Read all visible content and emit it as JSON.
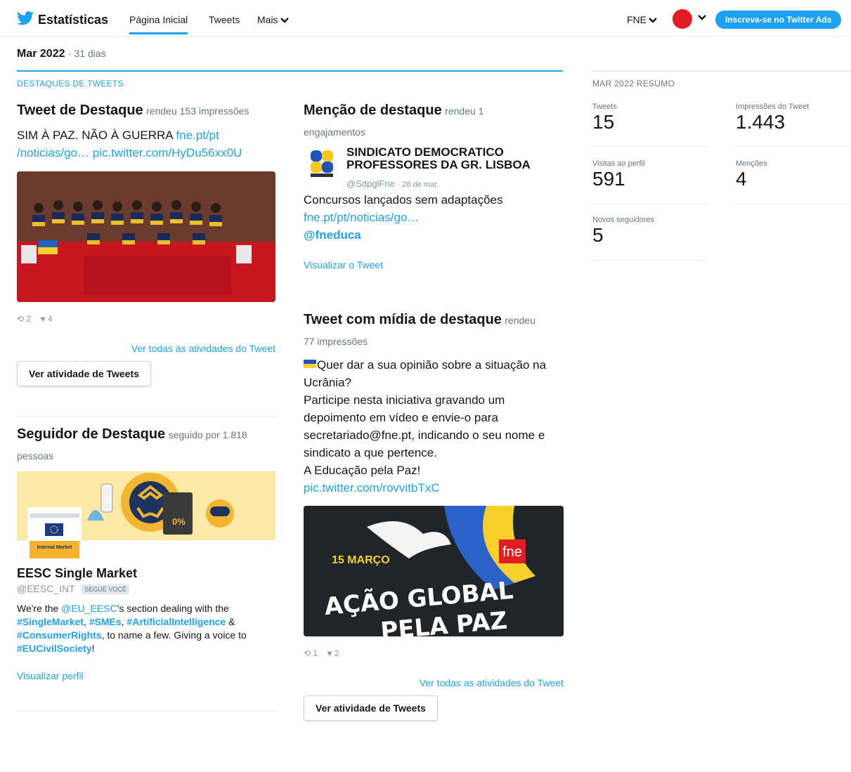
{
  "nav": {
    "brand": "Estatísticas",
    "tabs": [
      "Página Inicial",
      "Tweets",
      "Mais"
    ],
    "account": "FNE",
    "ads_button": "Inscreva-se no Twitter Ads"
  },
  "period": {
    "month": "Mar 2022",
    "days": "31 dias"
  },
  "highlights": {
    "header": "DESTAQUES DE TWEETS",
    "top_tweet": {
      "title": "Tweet de Destaque",
      "sub": "rendeu 153 impressões",
      "text": "SIM À PAZ. NÃO À GUERRA ",
      "link1": "fne.pt/pt",
      "link2": "/noticias/go…",
      "link3": "pic.twitter.com/HyDu56xx0U",
      "retweets": "2",
      "likes": "4",
      "view_all": "Ver todas as atividades do Tweet",
      "button": "Ver atividade de Tweets"
    },
    "top_follower": {
      "title": "Seguidor de Destaque",
      "sub": "seguido por 1.818",
      "sub2": "pessoas",
      "name": "EESC Single Market",
      "handle": "@EESC_INT",
      "badge": "SEGUE VOCÊ",
      "logo_text": "Internal Market",
      "bio": {
        "t1": "We're the ",
        "m1": "@EU_EESC",
        "t2": "'s section dealing with the ",
        "h1": "#SingleMarket",
        "t3": ", ",
        "h2": "#SMEs",
        "t4": ", ",
        "h3": "#ArtificialIntelligence",
        "t5": " & ",
        "h4": "#ConsumerRights",
        "t6": ", to name a few. Giving a voice to ",
        "h5": "#EUCivilSociety",
        "t7": "!"
      },
      "view_profile": "Visualizar perfil"
    },
    "top_mention": {
      "title": "Menção de destaque",
      "sub": "rendeu 1",
      "sub2": "engajamentos",
      "name": "SINDICATO DEMOCRATICO PROFESSORES DA GR. LISBOA",
      "handle": "@SdpglFne",
      "date": "· 28 de mar.",
      "text": "Concursos lançados sem adaptações",
      "link": "fne.pt/pt/noticias/go…",
      "mention": "@fneduca",
      "view": "Visualizar o Tweet"
    },
    "top_media": {
      "title": "Tweet com mídia de destaque",
      "sub": "rendeu",
      "sub2": "77 impressões",
      "lines": [
        "Quer dar a sua opinião sobre a situação na",
        "Ucrânia?",
        "Participe nesta iniciativa gravando um",
        "depoimento em vídeo e envie-o para",
        "secretariado@fne.pt, indicando o seu nome e",
        "sindicato a que pertence.",
        "A Educação pela Paz!"
      ],
      "link": "pic.twitter.com/rovvitbTxC",
      "image_date": "15 MARÇO",
      "image_line1": "AÇÃO GLOBAL",
      "image_line2": "PELA PAZ",
      "image_logo": "fne",
      "retweets": "1",
      "likes": "2",
      "view_all": "Ver todas as atividades do Tweet",
      "button": "Ver atividade de Tweets"
    }
  },
  "summary": {
    "header": "MAR 2022 RESUMO",
    "items": [
      {
        "label": "Tweets",
        "value": "15"
      },
      {
        "label": "Impressões do Tweet",
        "value": "1.443"
      },
      {
        "label": "Visitas ao perfil",
        "value": "591"
      },
      {
        "label": "Menções",
        "value": "4"
      },
      {
        "label": "Novos seguidores",
        "value": "5"
      }
    ]
  },
  "colors": {
    "accent": "#1da1f2",
    "muted": "#657786",
    "fne_red": "#e01b22"
  }
}
